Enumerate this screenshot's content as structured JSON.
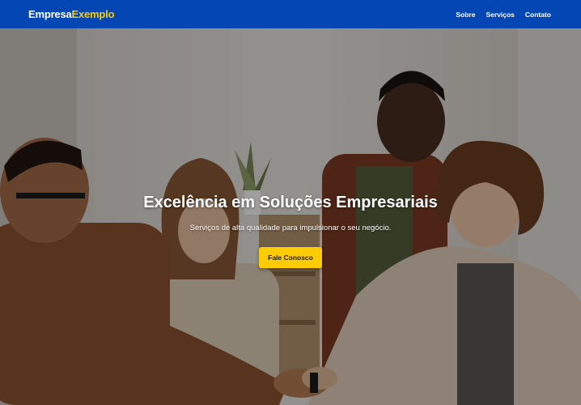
{
  "brand": {
    "part1": "Empresa",
    "part2": "Exemplo"
  },
  "nav": {
    "items": [
      "Sobre",
      "Serviços",
      "Contato"
    ]
  },
  "hero": {
    "title": "Excelência em Soluções Empresariais",
    "subtitle": "Serviços de alta qualidade para impulsionar o seu negócio.",
    "cta_label": "Fale Conosco",
    "background_image": "business-people-handshake-photo"
  },
  "colors": {
    "nav_bg": "#0346b4",
    "accent": "#ffcc00",
    "text": "#ffffff"
  }
}
